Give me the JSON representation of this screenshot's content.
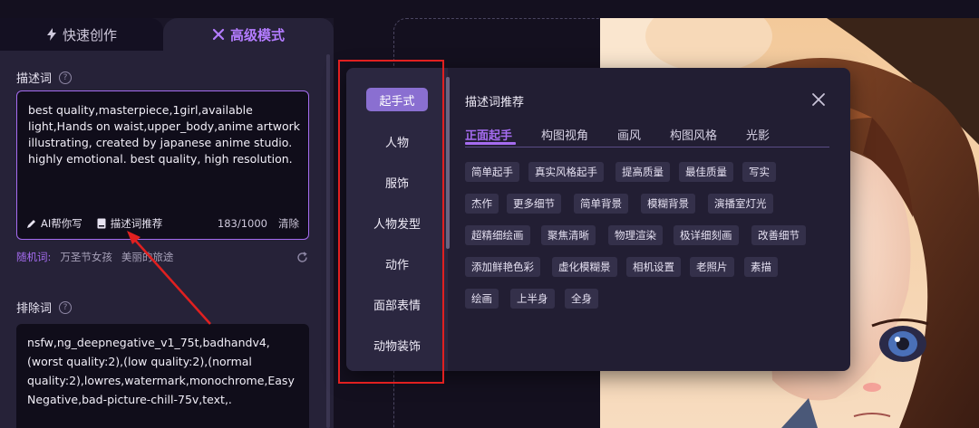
{
  "left_panel": {
    "tabs": [
      {
        "label": "快速创作",
        "icon": "lightning-icon"
      },
      {
        "label": "高级模式",
        "icon": "magic-wand-icon"
      }
    ],
    "prompt": {
      "label": "描述词",
      "help": "?",
      "text": "best quality,masterpiece,1girl,available light,Hands on waist,upper_body,anime artwork illustrating, created by japanese anime studio. highly emotional. best quality, high resolution.",
      "ai_write_label": "AI帮你写",
      "recommend_label": "描述词推荐",
      "count": "183/1000",
      "clear_label": "清除"
    },
    "random": {
      "label": "随机词:",
      "tags": [
        "万圣节女孩",
        "美丽的旅途"
      ]
    },
    "negative": {
      "label": "排除词",
      "help": "?",
      "text": "nsfw,ng_deepnegative_v1_75t,badhandv4,(worst quality:2),(low quality:2),(normal quality:2),lowres,watermark,monochrome,EasyNegative,bad-picture-chill-75v,text,."
    }
  },
  "popup": {
    "title": "描述词推荐",
    "categories": [
      "起手式",
      "人物",
      "服饰",
      "人物发型",
      "动作",
      "面部表情",
      "动物装饰"
    ],
    "active_category": "起手式",
    "sub_tabs": [
      "正面起手",
      "构图视角",
      "画风",
      "构图风格",
      "光影"
    ],
    "active_sub_tab": "正面起手",
    "tag_rows": [
      [
        "简单起手",
        "真实风格起手",
        "提高质量",
        "最佳质量",
        "写实"
      ],
      [
        "杰作",
        "更多细节",
        "简单背景",
        "模糊背景",
        "演播室灯光"
      ],
      [
        "超精细绘画",
        "聚焦清晰",
        "物理渲染",
        "极详细刻画",
        "改善细节"
      ],
      [
        "添加鲜艳色彩",
        "虚化模糊景",
        "相机设置",
        "老照片",
        "素描"
      ],
      [
        "绘画",
        "上半身",
        "全身"
      ]
    ]
  },
  "colors": {
    "accent": "#a56cf0",
    "active_category_bg": "#8a6fd1",
    "annotation": "#e02020"
  }
}
